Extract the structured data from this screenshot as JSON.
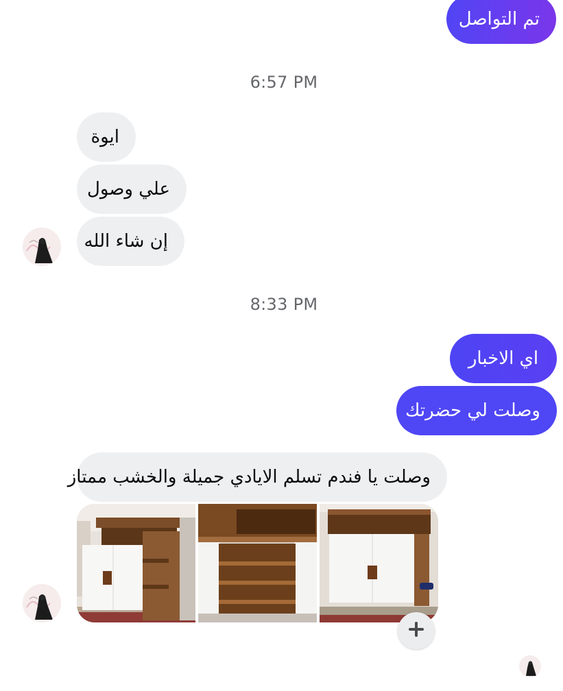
{
  "messages": {
    "m1": "تم التواصل",
    "m2": "ايوة",
    "m3": "علي وصول",
    "m4": "إن شاء الله",
    "m5": "اي الاخبار",
    "m6": "وصلت لي حضرتك",
    "m7": "وصلت يا فندم تسلم الايادي جميلة والخشب ممتاز"
  },
  "timestamps": {
    "t1": "6:57 PM",
    "t2": "8:33 PM"
  },
  "attachments": [
    {
      "name": "photo-cabinet-closed-angle"
    },
    {
      "name": "photo-cabinet-open-shelves"
    },
    {
      "name": "photo-cabinet-closed-front"
    }
  ],
  "icons": {
    "add": "plus-icon",
    "contact_avatar": "contact-avatar",
    "seen_avatar": "seen-avatar"
  },
  "colors": {
    "outgoing_gradient_start": "#5145f4",
    "outgoing_gradient_end": "#7a36ea",
    "outgoing_blue": "#4f46f5",
    "incoming_bubble": "#eeeff1",
    "timestamp_text": "#65676b"
  }
}
